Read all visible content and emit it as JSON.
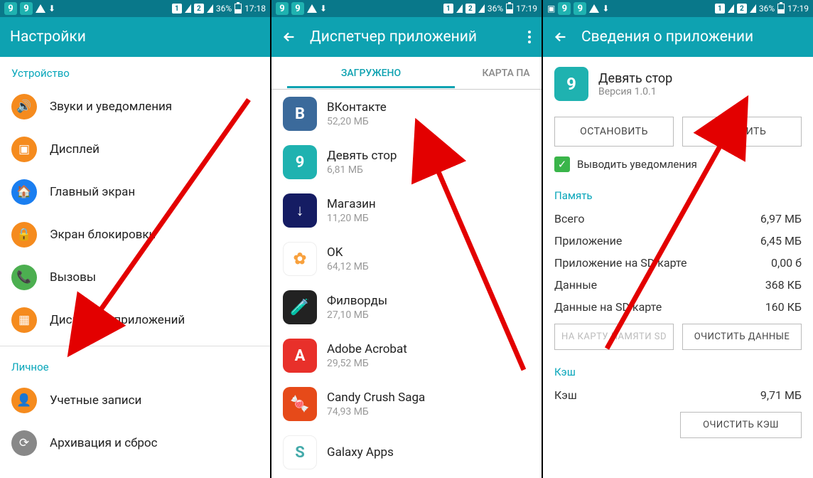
{
  "status": {
    "notif_icon_text": "9",
    "sim_label1": "1",
    "sim_label2": "2",
    "battery_pct": "36%",
    "time1": "17:18",
    "time2": "17:19"
  },
  "screen1": {
    "title": "Настройки",
    "section_device": "Устройство",
    "section_personal": "Личное",
    "items": [
      {
        "label": "Звуки и уведомления",
        "color": "#f58b1e"
      },
      {
        "label": "Дисплей",
        "color": "#f58b1e"
      },
      {
        "label": "Главный экран",
        "color": "#1a7ef0"
      },
      {
        "label": "Экран блокировки",
        "color": "#f58b1e"
      },
      {
        "label": "Вызовы",
        "color": "#4caf50"
      },
      {
        "label": "Диспетчер приложений",
        "color": "#f58b1e"
      }
    ],
    "personal_items": [
      {
        "label": "Учетные записи",
        "color": "#f58b1e"
      },
      {
        "label": "Архивация и сброс",
        "color": "#888"
      }
    ]
  },
  "screen2": {
    "title": "Диспетчер приложений",
    "tab_loaded": "ЗАГРУЖЕНО",
    "tab_sd": "КАРТА ПА",
    "apps": [
      {
        "name": "ВКонтакте",
        "size": "52,20 МБ",
        "bg": "#3b6a9b",
        "letter": "B"
      },
      {
        "name": "Девять стор",
        "size": "6,81 МБ",
        "bg": "#1fb2b0",
        "letter": "9"
      },
      {
        "name": "Магазин",
        "size": "11,20 МБ",
        "bg": "#151c63",
        "letter": "↓"
      },
      {
        "name": "OK",
        "size": "64,12 МБ",
        "bg": "#fff",
        "letter": "✿",
        "fg": "#f8a13e"
      },
      {
        "name": "Филворды",
        "size": "27,10 МБ",
        "bg": "#222",
        "letter": "🧪"
      },
      {
        "name": "Adobe Acrobat",
        "size": "29,52 МБ",
        "bg": "#e8302a",
        "letter": "A"
      },
      {
        "name": "Candy Crush Saga",
        "size": "74,93 МБ",
        "bg": "#e64a19",
        "letter": "🍬"
      },
      {
        "name": "Galaxy Apps",
        "size": "",
        "bg": "#fff",
        "letter": "S",
        "fg": "#4aa"
      }
    ]
  },
  "screen3": {
    "title": "Сведения о приложении",
    "app_name": "Девять стор",
    "app_version": "Версия 1.0.1",
    "btn_stop": "ОСТАНОВИТЬ",
    "btn_delete": "УДАЛИТЬ",
    "check_label": "Выводить уведомления",
    "section_memory": "Память",
    "rows": [
      {
        "k": "Всего",
        "v": "6,97 МБ"
      },
      {
        "k": "Приложение",
        "v": "6,45 МБ"
      },
      {
        "k": "Приложение на SD карте",
        "v": "0,00 б"
      },
      {
        "k": "Данные",
        "v": "368 КБ"
      },
      {
        "k": "Данные на SD карте",
        "v": "160 КБ"
      }
    ],
    "btn_sd": "НА КАРТУ ПАМЯТИ SD",
    "btn_clear": "ОЧИСТИТЬ ДАННЫЕ",
    "section_cache": "Кэш",
    "cache_label": "Кэш",
    "cache_value": "9,71 МБ",
    "btn_clear_cache": "ОЧИСТИТЬ КЭШ"
  }
}
